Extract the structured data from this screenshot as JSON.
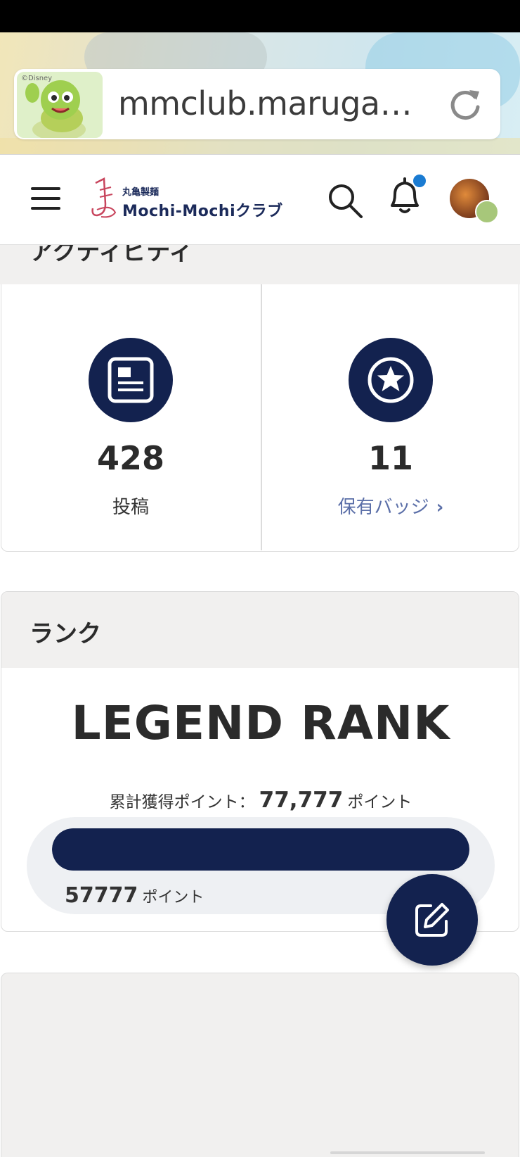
{
  "browser": {
    "url": "mmclub.maruga…",
    "tab_copyright": "©Disney"
  },
  "header": {
    "logo_small": "丸亀製麺",
    "logo_main": "Mochi-Mochiクラブ"
  },
  "activity": {
    "section_title": "アクティビティ",
    "posts": {
      "count": "428",
      "label": "投稿",
      "icon": "post-icon"
    },
    "badges": {
      "count": "11",
      "label": "保有バッジ",
      "icon": "star-badge-icon"
    }
  },
  "rank": {
    "section_title": "ランク",
    "rank_name": "LEGEND RANK",
    "total_label": "累計獲得ポイント：",
    "total_value": "77,777",
    "total_unit": "ポイント",
    "progress_value": "57777",
    "progress_unit": "ポイント",
    "progress_fraction": 1.0
  },
  "colors": {
    "navy": "#13224f",
    "link": "#5b6fa8",
    "notification": "#1a7bd2",
    "section_bg": "#f1f0ef"
  }
}
